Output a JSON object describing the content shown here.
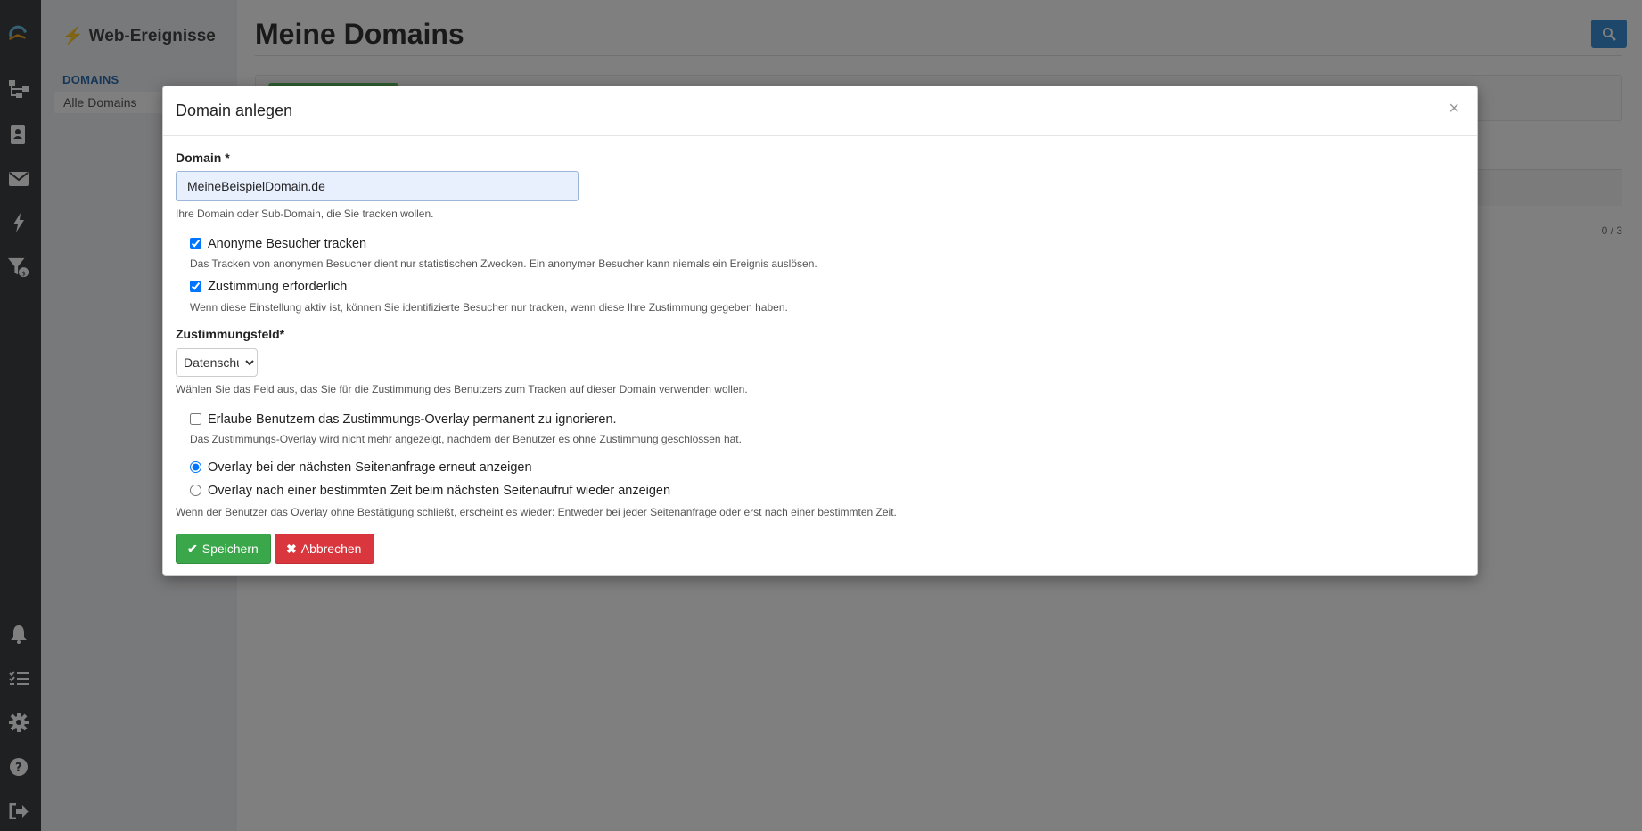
{
  "app": {
    "section_title": "Web-Ereignisse",
    "nav_section": "DOMAINS",
    "nav_item": "Alle Domains",
    "page_title": "Meine Domains",
    "pager": "0 / 3"
  },
  "rail_icons": [
    "logo-icon",
    "sitemap-icon",
    "contacts-icon",
    "mail-icon",
    "bolt-icon",
    "funnel-icon",
    "bell-icon",
    "tasks-icon",
    "gear-icon",
    "help-icon",
    "logout-icon"
  ],
  "modal": {
    "title": "Domain anlegen",
    "close": "×",
    "domain_label": "Domain *",
    "domain_value": "MeineBeispielDomain.de",
    "domain_help": "Ihre Domain oder Sub-Domain, die Sie tracken wollen.",
    "anon_label": "Anonyme Besucher tracken",
    "anon_help": "Das Tracken von anonymen Besucher dient nur statistischen Zwecken. Ein anonymer Besucher kann niemals ein Ereignis auslösen.",
    "consent_label": "Zustimmung erforderlich",
    "consent_help": "Wenn diese Einstellung aktiv ist, können Sie identifizierte Besucher nur tracken, wenn diese Ihre Zustimmung gegeben haben.",
    "field_label": "Zustimmungsfeld*",
    "field_value": "Datenschutz",
    "field_help": "Wählen Sie das Feld aus, das Sie für die Zustimmung des Benutzers zum Tracken auf dieser Domain verwenden wollen.",
    "ignore_label": "Erlaube Benutzern das Zustimmungs-Overlay permanent zu ignorieren.",
    "ignore_help": "Das Zustimmungs-Overlay wird nicht mehr angezeigt, nachdem der Benutzer es ohne Zustimmung geschlossen hat.",
    "radio1_label": "Overlay bei der nächsten Seitenanfrage erneut anzeigen",
    "radio2_label": "Overlay nach einer bestimmten Zeit beim nächsten Seitenaufruf wieder anzeigen",
    "radio_help": "Wenn der Benutzer das Overlay ohne Bestätigung schließt, erscheint es wieder: Entweder bei jeder Seitenanfrage oder erst nach einer bestimmten Zeit.",
    "save_label": "Speichern",
    "cancel_label": "Abbrechen",
    "save_glyph": "✔",
    "cancel_glyph": "✖"
  },
  "colors": {
    "save": "#3aa84a",
    "cancel": "#d9363e",
    "search": "#3a8fd6"
  }
}
